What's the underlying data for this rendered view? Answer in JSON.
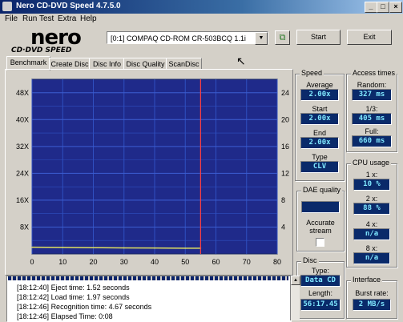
{
  "window": {
    "title": "Nero CD-DVD Speed 4.7.5.0"
  },
  "menu": {
    "items": [
      "File",
      "Run Test",
      "Extra",
      "Help"
    ]
  },
  "header": {
    "logo_top": "nero",
    "logo_bottom": "CD·DVD SPEED",
    "drive": "[0:1]  COMPAQ CD-ROM CR-503BCQ 1.1i",
    "start_label": "Start",
    "exit_label": "Exit"
  },
  "tabs": [
    "Benchmark",
    "Create Disc",
    "Disc Info",
    "Disc Quality",
    "ScanDisc"
  ],
  "speed": {
    "title": "Speed",
    "average_label": "Average",
    "average_value": "2.00x",
    "start_label": "Start",
    "start_value": "2.00x",
    "end_label": "End",
    "end_value": "2.00x",
    "type_label": "Type",
    "type_value": "CLV"
  },
  "access": {
    "title": "Access times",
    "random_label": "Random:",
    "random_value": "327 ms",
    "third_label": "1/3:",
    "third_value": "405 ms",
    "full_label": "Full:",
    "full_value": "660 ms"
  },
  "cpu": {
    "title": "CPU usage",
    "x1_label": "1 x:",
    "x1_value": "10 %",
    "x2_label": "2 x:",
    "x2_value": "88 %",
    "x4_label": "4 x:",
    "x4_value": "n/a",
    "x8_label": "8 x:",
    "x8_value": "n/a"
  },
  "dae": {
    "title": "DAE quality",
    "value": "",
    "accurate_label": "Accurate stream"
  },
  "disc": {
    "title": "Disc",
    "type_label": "Type:",
    "type_value": "Data CD",
    "length_label": "Length:",
    "length_value": "56:17.45"
  },
  "interface": {
    "title": "Interface",
    "burst_label": "Burst rate:",
    "burst_value": "2 MB/s"
  },
  "log": [
    {
      "time": "[18:12:40]",
      "text": "Eject time: 1.52 seconds"
    },
    {
      "time": "[18:12:42]",
      "text": "Load time: 1.97 seconds"
    },
    {
      "time": "[18:12:46]",
      "text": "Recognition time: 4.67 seconds"
    },
    {
      "time": "[18:12:46]",
      "text": "Elapsed Time: 0:08"
    }
  ],
  "colors": {
    "chart_bg": "#1f2a8a",
    "grid": "#2f4fc0",
    "transfer": "#e0e060",
    "marker": "#ff4040",
    "readout_bg": "#0a2a6a",
    "readout_fg": "#7fe8ff"
  },
  "chart_data": {
    "type": "line",
    "x_ticks": [
      0,
      10,
      20,
      30,
      40,
      50,
      60,
      70,
      80
    ],
    "y_left_ticks": [
      "8X",
      "16X",
      "24X",
      "32X",
      "40X",
      "48X"
    ],
    "y_right_ticks": [
      4,
      8,
      12,
      16,
      20,
      24
    ],
    "xlim": [
      0,
      80
    ],
    "ylim_left": [
      0,
      52
    ],
    "ylim_right": [
      0,
      26
    ],
    "grid": true,
    "series": [
      {
        "x": [
          0,
          10,
          20,
          30,
          40,
          50,
          55
        ],
        "y": [
          2.0,
          1.95,
          1.85,
          1.8,
          1.75,
          1.7,
          1.7
        ]
      }
    ],
    "marker_x": 55
  }
}
